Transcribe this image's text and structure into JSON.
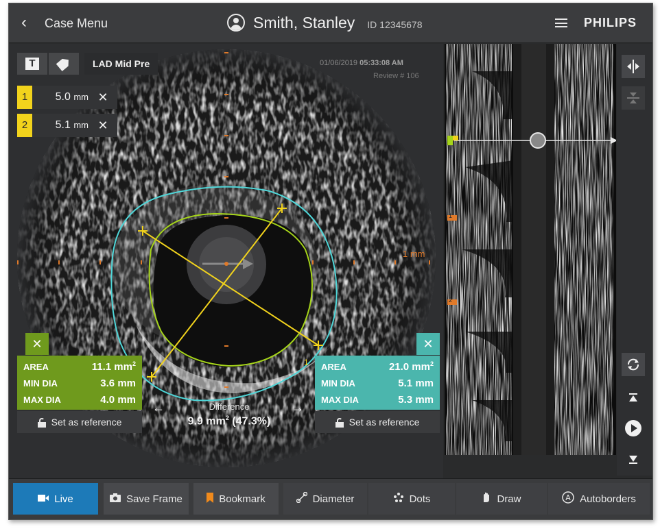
{
  "header": {
    "back_label": "Case Menu",
    "patient_name": "Smith, Stanley",
    "patient_id": "ID 12345678",
    "brand": "PHILIPS"
  },
  "viewer": {
    "segment_label": "LAD Mid Pre",
    "date": "01/06/2019",
    "time": "05:33:08 AM",
    "review": "Review # 106",
    "scale_label": "1 mm",
    "measurements": [
      {
        "index": "1",
        "value": "5.0",
        "unit": "mm"
      },
      {
        "index": "2",
        "value": "5.1",
        "unit": "mm"
      }
    ],
    "endpoint_labels": [
      "2",
      "1"
    ]
  },
  "panel_lumen": {
    "color": "#6f9a1d",
    "rows": [
      {
        "label": "AREA",
        "value": "11.1 mm",
        "sup": "2"
      },
      {
        "label": "MIN DIA",
        "value": "3.6 mm",
        "sup": ""
      },
      {
        "label": "MAX DIA",
        "value": "4.0 mm",
        "sup": ""
      }
    ],
    "reference_label": "Set as reference"
  },
  "panel_vessel": {
    "color": "#4bb6ad",
    "rows": [
      {
        "label": "AREA",
        "value": "21.0 mm",
        "sup": "2"
      },
      {
        "label": "MIN DIA",
        "value": "5.1 mm",
        "sup": ""
      },
      {
        "label": "MAX DIA",
        "value": "5.3 mm",
        "sup": ""
      }
    ],
    "reference_label": "Set as reference"
  },
  "difference": {
    "label": "Difference",
    "area": "9.9 mm",
    "area_sup": "2",
    "percent": "(47.3%)"
  },
  "longitudinal": {
    "bookmarks": [
      "1",
      "2"
    ]
  },
  "toolbar": {
    "live": "Live",
    "save_frame": "Save Frame",
    "bookmark": "Bookmark",
    "diameter": "Diameter",
    "dots": "Dots",
    "draw": "Draw",
    "autoborders": "Autoborders"
  },
  "colors": {
    "accent_live": "#1d7ab8",
    "lumen_border": "#a6d51a",
    "vessel_border": "#4fd6d8",
    "measure_line": "#f2d31c",
    "scale_marks": "#e07a2a"
  }
}
